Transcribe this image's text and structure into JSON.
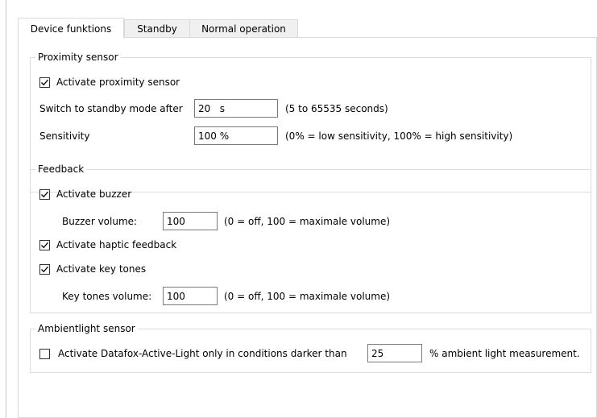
{
  "tabs": [
    {
      "label": "Device funktions",
      "active": true
    },
    {
      "label": "Standby",
      "active": false
    },
    {
      "label": "Normal operation",
      "active": false
    }
  ],
  "proximity": {
    "title": "Proximity sensor",
    "activate_label": "Activate proximity sensor",
    "activate_checked": true,
    "switch_label": "Switch to standby mode after",
    "switch_value": "20   s",
    "switch_hint": "(5 to 65535 seconds)",
    "sensitivity_label": "Sensitivity",
    "sensitivity_value": "100 %",
    "sensitivity_hint": "(0% = low sensitivity, 100% = high sensitivity)"
  },
  "feedback": {
    "title": "Feedback",
    "buzzer_label": "Activate buzzer",
    "buzzer_checked": true,
    "buzzer_volume_label": "Buzzer volume:",
    "buzzer_volume_value": "100",
    "buzzer_volume_hint": "(0 = off, 100 = maximale volume)",
    "haptic_label": "Activate haptic feedback",
    "haptic_checked": true,
    "keytones_label": "Activate key tones",
    "keytones_checked": true,
    "keytones_volume_label": "Key tones volume:",
    "keytones_volume_value": "100",
    "keytones_volume_hint": "(0 = off, 100 = maximale volume)"
  },
  "ambient": {
    "title": "Ambientlight sensor",
    "activate_label": "Activate Datafox-Active-Light only in conditions darker than",
    "activate_checked": false,
    "value": "25",
    "suffix": "% ambient light measurement."
  }
}
